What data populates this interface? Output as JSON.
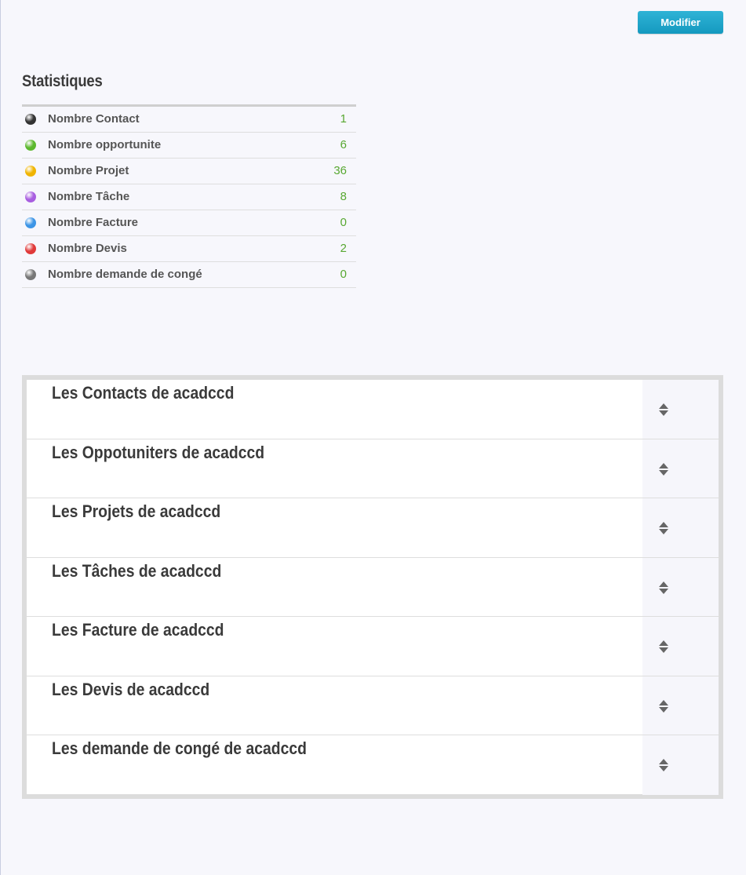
{
  "toolbar": {
    "modify_label": "Modifier"
  },
  "stats": {
    "title": "Statistiques",
    "rows": [
      {
        "label": "Nombre Contact",
        "value": "1",
        "dot_color": "#333333"
      },
      {
        "label": "Nombre opportunite",
        "value": "6",
        "dot_color": "#5cb82e"
      },
      {
        "label": "Nombre Projet",
        "value": "36",
        "dot_color": "#f0b400"
      },
      {
        "label": "Nombre Tâche",
        "value": "8",
        "dot_color": "#a85ee0"
      },
      {
        "label": "Nombre Facture",
        "value": "0",
        "dot_color": "#3d95e6"
      },
      {
        "label": "Nombre Devis",
        "value": "2",
        "dot_color": "#e03a3a"
      },
      {
        "label": "Nombre demande de congé",
        "value": "0",
        "dot_color": "#777777"
      }
    ]
  },
  "accordion": {
    "items": [
      {
        "title": "Les Contacts de acadccd",
        "icon": "sort-icon"
      },
      {
        "title": "Les Oppotuniters de acadccd",
        "icon": "sort-icon"
      },
      {
        "title": "Les Projets de acadccd",
        "icon": "sort-icon"
      },
      {
        "title": "Les Tâches de acadccd",
        "icon": "sort-icon"
      },
      {
        "title": "Les Facture de acadccd",
        "icon": "sort-icon"
      },
      {
        "title": "Les Devis de acadccd",
        "icon": "sort-icon"
      },
      {
        "title": "Les demande de congé de acadccd",
        "icon": "sort-icon"
      }
    ]
  }
}
